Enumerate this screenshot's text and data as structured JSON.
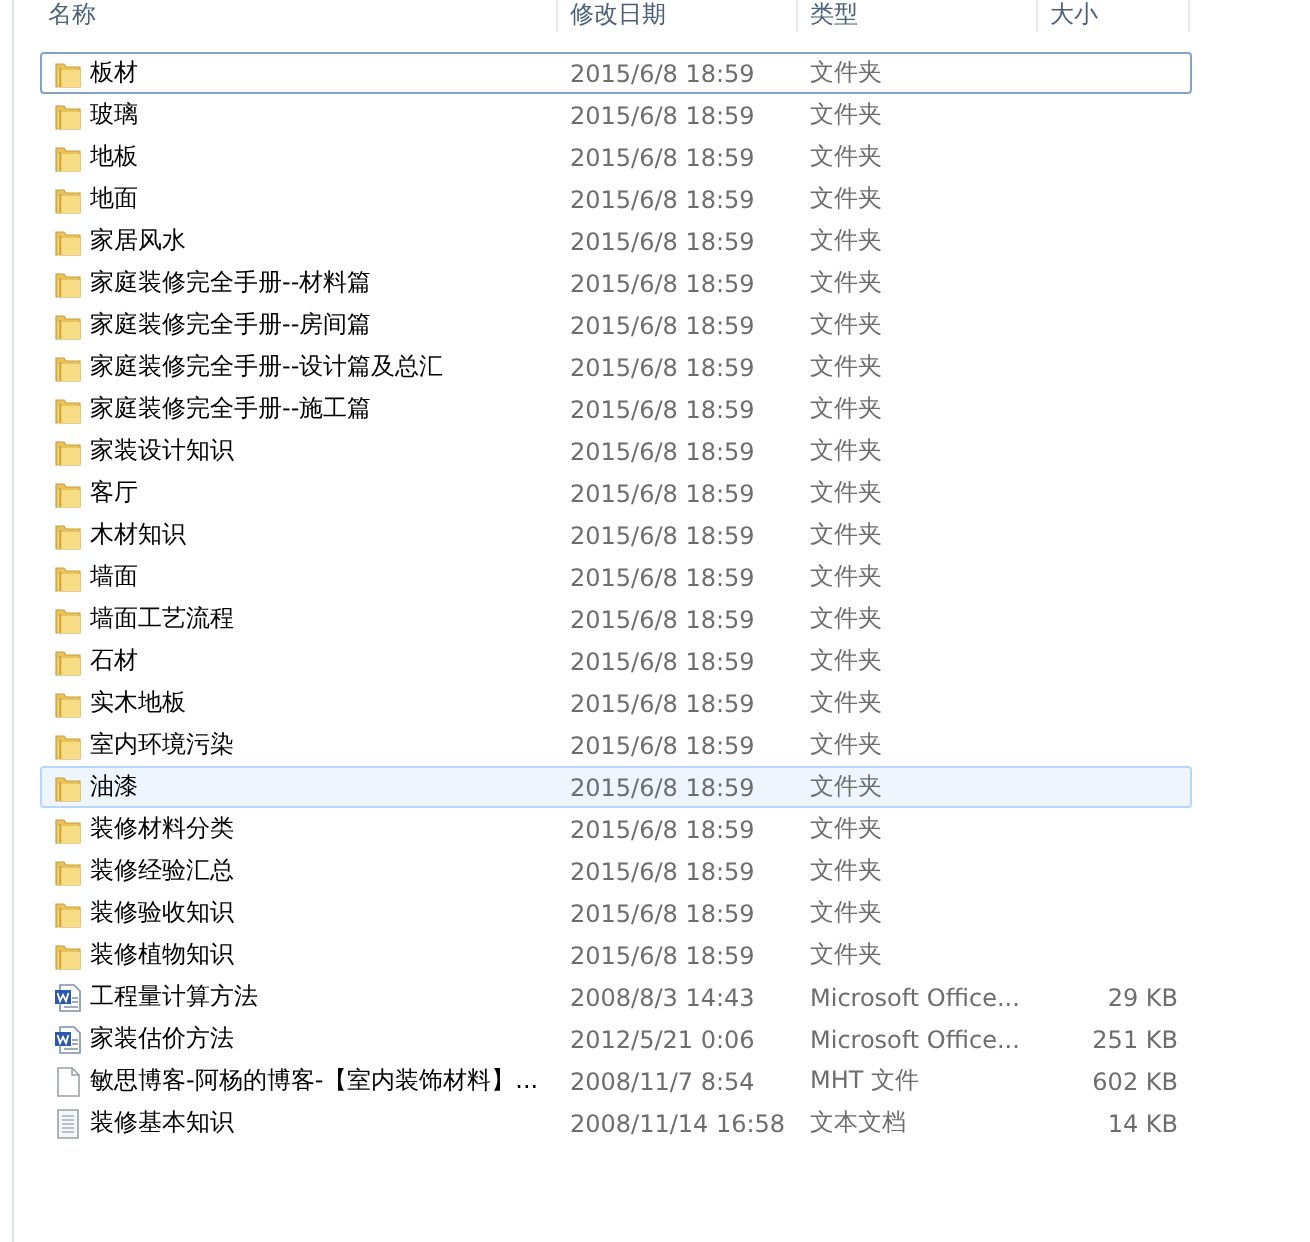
{
  "columns": [
    "名称",
    "修改日期",
    "类型",
    "大小"
  ],
  "files": [
    {
      "kind": "folder",
      "name": "板材",
      "date": "2015/6/8 18:59",
      "type": "文件夹",
      "focused": true,
      "highlighted": false
    },
    {
      "kind": "folder",
      "name": "玻璃",
      "date": "2015/6/8 18:59",
      "type": "文件夹",
      "focused": false,
      "highlighted": false
    },
    {
      "kind": "folder",
      "name": "地板",
      "date": "2015/6/8 18:59",
      "type": "文件夹",
      "focused": false,
      "highlighted": false
    },
    {
      "kind": "folder",
      "name": "地面",
      "date": "2015/6/8 18:59",
      "type": "文件夹",
      "focused": false,
      "highlighted": false
    },
    {
      "kind": "folder",
      "name": "家居风水",
      "date": "2015/6/8 18:59",
      "type": "文件夹",
      "focused": false,
      "highlighted": false
    },
    {
      "kind": "folder",
      "name": "家庭装修完全手册--材料篇",
      "date": "2015/6/8 18:59",
      "type": "文件夹",
      "focused": false,
      "highlighted": false
    },
    {
      "kind": "folder",
      "name": "家庭装修完全手册--房间篇",
      "date": "2015/6/8 18:59",
      "type": "文件夹",
      "focused": false,
      "highlighted": false
    },
    {
      "kind": "folder",
      "name": "家庭装修完全手册--设计篇及总汇",
      "date": "2015/6/8 18:59",
      "type": "文件夹",
      "focused": false,
      "highlighted": false
    },
    {
      "kind": "folder",
      "name": "家庭装修完全手册--施工篇",
      "date": "2015/6/8 18:59",
      "type": "文件夹",
      "focused": false,
      "highlighted": false
    },
    {
      "kind": "folder",
      "name": "家装设计知识",
      "date": "2015/6/8 18:59",
      "type": "文件夹",
      "focused": false,
      "highlighted": false
    },
    {
      "kind": "folder",
      "name": "客厅",
      "date": "2015/6/8 18:59",
      "type": "文件夹",
      "focused": false,
      "highlighted": false
    },
    {
      "kind": "folder",
      "name": "木材知识",
      "date": "2015/6/8 18:59",
      "type": "文件夹",
      "focused": false,
      "highlighted": false
    },
    {
      "kind": "folder",
      "name": "墙面",
      "date": "2015/6/8 18:59",
      "type": "文件夹",
      "focused": false,
      "highlighted": false
    },
    {
      "kind": "folder",
      "name": "墙面工艺流程",
      "date": "2015/6/8 18:59",
      "type": "文件夹",
      "focused": false,
      "highlighted": false
    },
    {
      "kind": "folder",
      "name": "石材",
      "date": "2015/6/8 18:59",
      "type": "文件夹",
      "focused": false,
      "highlighted": false
    },
    {
      "kind": "folder",
      "name": "实木地板",
      "date": "2015/6/8 18:59",
      "type": "文件夹",
      "focused": false,
      "highlighted": false
    },
    {
      "kind": "folder",
      "name": "室内环境污染",
      "date": "2015/6/8 18:59",
      "type": "文件夹",
      "focused": false,
      "highlighted": false
    },
    {
      "kind": "folder",
      "name": "油漆",
      "date": "2015/6/8 18:59",
      "type": "文件夹",
      "focused": false,
      "highlighted": true
    },
    {
      "kind": "folder",
      "name": "装修材料分类",
      "date": "2015/6/8 18:59",
      "type": "文件夹",
      "focused": false,
      "highlighted": false
    },
    {
      "kind": "folder",
      "name": "装修经验汇总",
      "date": "2015/6/8 18:59",
      "type": "文件夹",
      "focused": false,
      "highlighted": false
    },
    {
      "kind": "folder",
      "name": "装修验收知识",
      "date": "2015/6/8 18:59",
      "type": "文件夹",
      "focused": false,
      "highlighted": false
    },
    {
      "kind": "folder",
      "name": "装修植物知识",
      "date": "2015/6/8 18:59",
      "type": "文件夹",
      "focused": false,
      "highlighted": false
    },
    {
      "kind": "word",
      "name": "工程量计算方法",
      "date": "2008/8/3 14:43",
      "type": "Microsoft Office...",
      "size": "29 KB",
      "focused": false,
      "highlighted": false
    },
    {
      "kind": "word",
      "name": "家装估价方法",
      "date": "2012/5/21 0:06",
      "type": "Microsoft Office...",
      "size": "251 KB",
      "focused": false,
      "highlighted": false
    },
    {
      "kind": "blank",
      "name": "敏思博客-阿杨的博客-【室内装饰材料】...",
      "date": "2008/11/7 8:54",
      "type": "MHT 文件",
      "size": "602 KB",
      "focused": false,
      "highlighted": false
    },
    {
      "kind": "text",
      "name": "装修基本知识",
      "date": "2008/11/14 16:58",
      "type": "文本文档",
      "size": "14 KB",
      "focused": false,
      "highlighted": false
    }
  ]
}
